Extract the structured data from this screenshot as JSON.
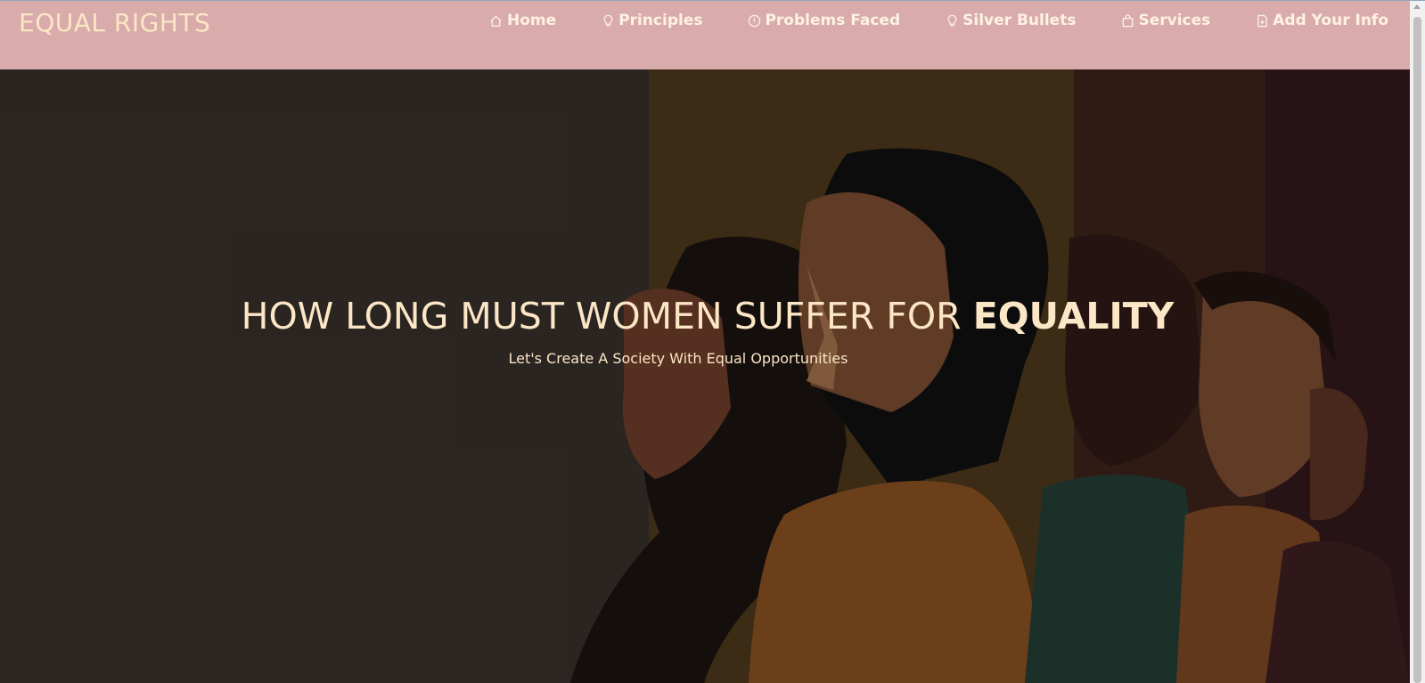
{
  "brand": {
    "title": "EQUAL RIGHTS"
  },
  "nav": {
    "items": [
      {
        "label": "Home",
        "icon": "home-icon"
      },
      {
        "label": "Principles",
        "icon": "lightbulb-icon"
      },
      {
        "label": "Problems Faced",
        "icon": "alert-circle-icon"
      },
      {
        "label": "Silver Bullets",
        "icon": "lightbulb-icon"
      },
      {
        "label": "Services",
        "icon": "bag-icon"
      },
      {
        "label": "Add Your Info",
        "icon": "file-plus-icon"
      }
    ]
  },
  "hero": {
    "title_main": "HOW LONG MUST WOMEN SUFFER FOR ",
    "title_emphasis": "EQUALITY",
    "subtitle": "Let's Create A Society With Equal Opportunities"
  },
  "colors": {
    "navbar_bg": "#d9acab",
    "brand_text": "#fbe6c5",
    "nav_text": "#fdf2e3",
    "hero_bg": "#332d28",
    "hero_text": "#fbe6c5"
  }
}
